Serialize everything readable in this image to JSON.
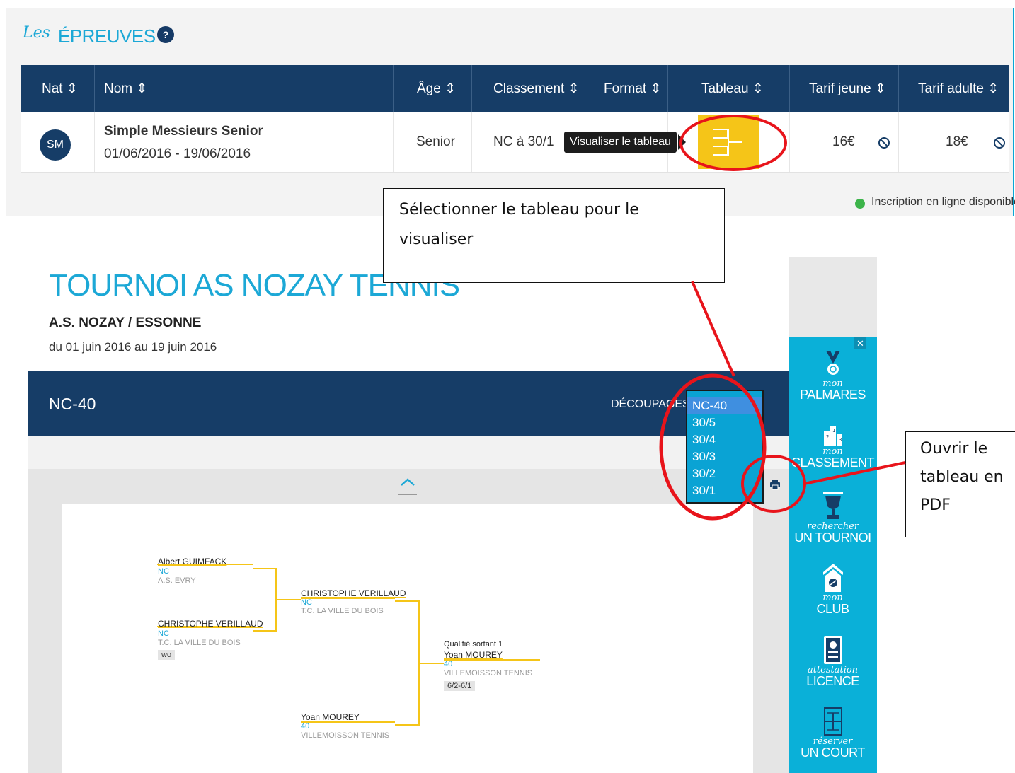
{
  "epreuves": {
    "script": "Les",
    "title": "ÉPREUVES",
    "help": "?"
  },
  "table": {
    "headers": [
      "Nat ⇕",
      "Nom ⇕",
      "Âge ⇕",
      "Classement ⇕",
      "Format ⇕",
      "Tableau ⇕",
      "Tarif jeune ⇕",
      "Tarif adulte ⇕"
    ],
    "row": {
      "badge": "SM",
      "name": "Simple Messieurs Senior",
      "dates": "01/06/2016 - 19/06/2016",
      "age": "Senior",
      "classement": "NC à 30/1",
      "tooltip": "Visualiser le tableau",
      "tarif_jeune": "16€",
      "tarif_adulte": "18€"
    },
    "online": "Inscription en ligne disponible"
  },
  "callouts": {
    "select_table": "Sélectionner le tableau pour le visualiser",
    "open_pdf": "Ouvrir le tableau en PDF"
  },
  "tournament": {
    "title": "TOURNOI AS NOZAY TENNIS",
    "club": "A.S. NOZAY / ESSONNE",
    "dates": "du 01 juin 2016 au 19 juin 2016",
    "current_table": "NC-40",
    "decoupages_label": "DÉCOUPAGES",
    "decoupages_options": [
      "NC-40",
      "30/5",
      "30/4",
      "30/3",
      "30/2",
      "30/1"
    ],
    "selected_option": "NC-40"
  },
  "bracket": {
    "r1_p1": {
      "name": "Albert GUIMFACK",
      "rank": "NC",
      "club": "A.S. EVRY"
    },
    "r1_p2": {
      "name": "CHRISTOPHE VERILLAUD",
      "rank": "NC",
      "club": "T.C. LA VILLE DU BOIS",
      "score": "wo"
    },
    "r2_p1": {
      "name": "CHRISTOPHE VERILLAUD",
      "rank": "NC",
      "club": "T.C. LA VILLE DU BOIS"
    },
    "r2_p2": {
      "name": "Yoan MOUREY",
      "rank": "40",
      "club": "VILLEMOISSON TENNIS"
    },
    "r3": {
      "qualifier": "Qualifié sortant 1",
      "name": "Yoan MOUREY",
      "rank": "40",
      "club": "VILLEMOISSON TENNIS",
      "score": "6/2-6/1"
    }
  },
  "sidebar": {
    "close": "✕",
    "items": [
      {
        "script": "mon",
        "main": "PALMARES",
        "icon": "medal-icon"
      },
      {
        "script": "mon",
        "main": "CLASSEMENT",
        "icon": "podium-icon"
      },
      {
        "script": "rechercher",
        "main": "UN TOURNOI",
        "icon": "trophy-icon"
      },
      {
        "script": "mon",
        "main": "CLUB",
        "icon": "club-house-icon"
      },
      {
        "script": "attestation",
        "main": "LICENCE",
        "icon": "license-card-icon"
      },
      {
        "script": "réserver",
        "main": "UN COURT",
        "icon": "court-icon"
      }
    ]
  },
  "colors": {
    "navy": "#163d67",
    "cyan": "#1ca8d6",
    "yellow": "#f5c518",
    "annotation_red": "#e8141b"
  }
}
